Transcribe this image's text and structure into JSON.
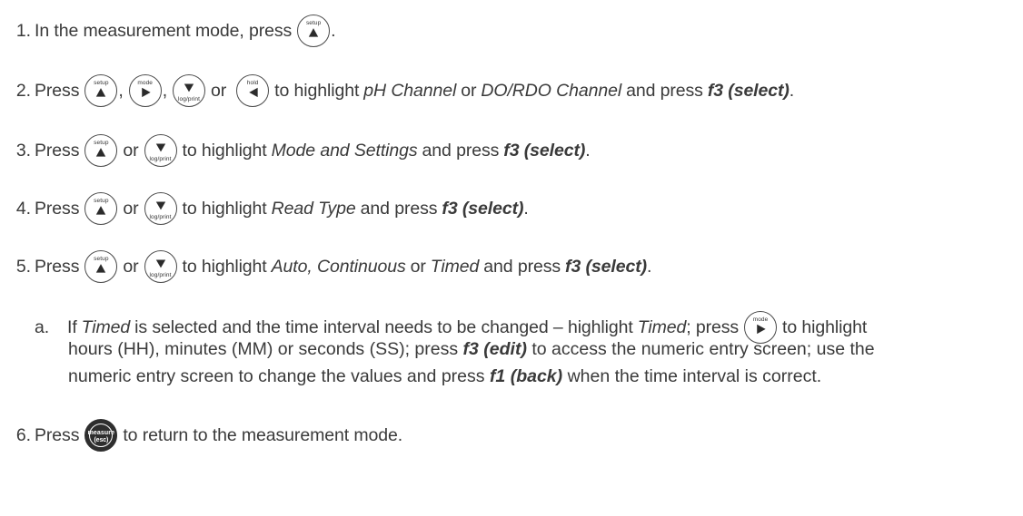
{
  "icons": {
    "setup": {
      "name": "setup-up-arrow-button-icon",
      "label": "setup"
    },
    "mode": {
      "name": "mode-right-arrow-button-icon",
      "label": "mode"
    },
    "logprint": {
      "name": "log-print-down-arrow-button-icon",
      "label": "log/print"
    },
    "hold": {
      "name": "hold-left-arrow-button-icon",
      "label": "hold"
    },
    "measure": {
      "name": "measure-esc-button-icon",
      "label": "measure",
      "label2": "(esc)"
    }
  },
  "steps": {
    "s1": {
      "num": "1.",
      "text1": "In the measurement mode, press",
      "text2": "."
    },
    "s2": {
      "num": "2.",
      "press": "Press",
      "comma1": ",",
      "comma2": ",",
      "or": "or",
      "to_highlight": "to highlight",
      "opt1": "pH Channel",
      "or2": "or",
      "opt2": "DO/RDO Channel",
      "and_press": "and press",
      "key": "f3 (select)",
      "end": "."
    },
    "s3": {
      "num": "3.",
      "press": "Press",
      "or": "or",
      "to_highlight": "to highlight",
      "opt": "Mode and Settings",
      "and_press": "and press",
      "key": "f3 (select)",
      "end": "."
    },
    "s4": {
      "num": "4.",
      "press": "Press",
      "or": "or",
      "to_highlight": "to highlight",
      "opt": "Read Type",
      "and_press": "and press",
      "key": "f3 (select)",
      "end": "."
    },
    "s5": {
      "num": "5.",
      "press": "Press",
      "or": "or",
      "to_highlight": "to highlight",
      "opt1": "Auto, Continuous",
      "or2": "or",
      "opt2": "Timed",
      "and_press": "and press",
      "key": "f3 (select)",
      "end": "."
    },
    "s5a": {
      "letter": "a.",
      "t1": "If",
      "timed1": "Timed",
      "t2": "is selected and the time interval needs to be changed – highlight",
      "timed2": "Timed",
      "t3": "; press",
      "t4": "to highlight",
      "l2a": "hours (HH), minutes (MM) or seconds (SS); press",
      "edit": "f3 (edit)",
      "l2b": "to access the numeric entry screen; use the",
      "l3a": "numeric entry screen to change the values and press",
      "back": "f1 (back)",
      "l3b": "when the time interval is correct."
    },
    "s6": {
      "num": "6.",
      "press": "Press",
      "text": "to return to the measurement mode."
    }
  }
}
